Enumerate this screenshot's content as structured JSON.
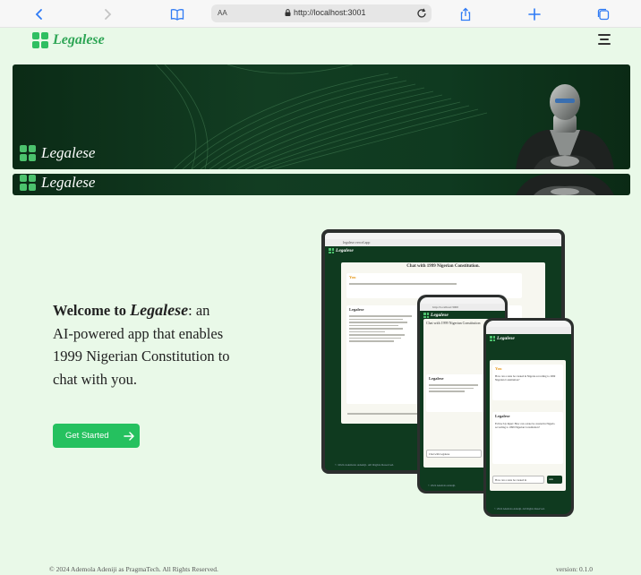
{
  "browser": {
    "text_size_label": "AA",
    "url": "http://localhost:3001",
    "icons": [
      "chevron-left-icon",
      "chevron-right-icon",
      "book-icon",
      "lock-icon",
      "reload-icon",
      "share-icon",
      "plus-icon",
      "tabs-icon"
    ]
  },
  "header": {
    "brand": "Legalese",
    "accent": "#2fbf62"
  },
  "banner": {
    "brand": "Legalese",
    "brand_repeat": "Legalese"
  },
  "welcome": {
    "prefix": "Welcome to ",
    "brand": "Legalese",
    "suffix": ":",
    "body": "an AI-powered app that enables 1999 Nigerian Constitution to chat with you.",
    "cta_label": "Get Started"
  },
  "mockup": {
    "tablet_url": "legalese.vercel.app",
    "tablet_brand": "Legalese",
    "tablet_title": "Chat with 1999 Nigerian Constitution.",
    "you_label": "You",
    "legalese_label": "Legalese",
    "phone1_url": "http://localhost:3000",
    "phone1_brand": "Legalese",
    "phone1_title": "Chat with 1999 Nigerian Constitution",
    "phone1_input": "Chat with Legalese",
    "phone1_footer": "© 2024 Ademola Adeniji.",
    "phone2_brand": "Legalese",
    "phone2_you_text": "How can a state be created in Nigeria according to 1999 Nigerian Constitution?",
    "phone2_legalese_text": "Follow Up Input: How can a state be created in Nigeria according to 1999 Nigerian Constitution?",
    "phone2_input": "How can a state be created in",
    "phone2_ask": "Ask",
    "phone2_footer": "© 2024 Ademola Adeniji. All Rights Reserved.",
    "tablet_footer": "© 2024 Ademola Adeniji. All Rights Reserved."
  },
  "footer": {
    "copyright": "© 2024 Ademola Adeniji as PragmaTech. All Rights Reserved.",
    "version": "version: 0.1.0"
  }
}
